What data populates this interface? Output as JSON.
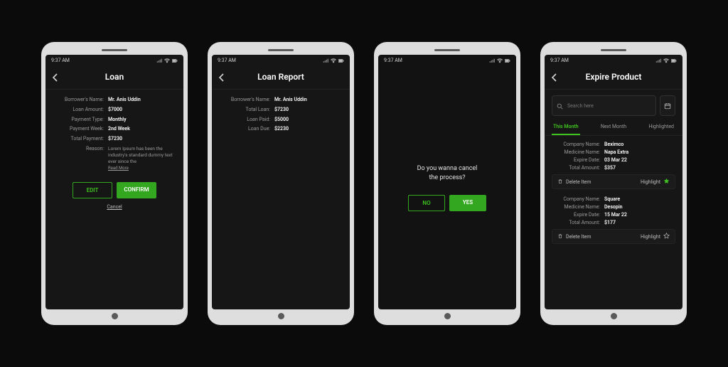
{
  "status": {
    "time": "9:37 AM"
  },
  "screen1": {
    "title": "Loan",
    "fields": {
      "borrower_label": "Borrower's Name:",
      "borrower_value": "Mr. Anis Uddin",
      "loan_amount_label": "Loan Amount:",
      "loan_amount_value": "$7000",
      "payment_type_label": "Payment Type:",
      "payment_type_value": "Monthly",
      "payment_week_label": "Payment Week:",
      "payment_week_value": "2nd Week",
      "total_payment_label": "Total Payment:",
      "total_payment_value": "$7230",
      "reason_label": "Reason:",
      "reason_value": "Lorem Ipsum has been the industry's standard dummy text ever since the",
      "readmore": "Read More"
    },
    "buttons": {
      "edit": "EDIT",
      "confirm": "CONFIRM",
      "cancel": "Cancel"
    }
  },
  "screen2": {
    "title": "Loan Report",
    "fields": {
      "borrower_label": "Borrower's Name:",
      "borrower_value": "Mr. Anis Uddin",
      "total_loan_label": "Total Loan:",
      "total_loan_value": "$7230",
      "loan_paid_label": "Loan Paid:",
      "loan_paid_value": "$5000",
      "loan_due_label": "Loan Due:",
      "loan_due_value": "$2230"
    }
  },
  "screen3": {
    "prompt_l1": "Do you wanna cancel",
    "prompt_l2": "the process?",
    "no": "NO",
    "yes": "YES"
  },
  "screen4": {
    "title": "Expire Product",
    "search_placeholder": "Search here",
    "tabs": {
      "this": "This Month",
      "next": "Next Month",
      "highlighted": "Highlighted"
    },
    "labels": {
      "company": "Company Name:",
      "medicine": "Medicine Name:",
      "expire": "Expire Date:",
      "total": "Total Amount:",
      "delete": "Delete Item",
      "highlight": "Highlight"
    },
    "items": [
      {
        "company": "Beximco",
        "medicine": "Napa Extra",
        "expire": "03 Mar 22",
        "total": "$357",
        "highlighted": true
      },
      {
        "company": "Square",
        "medicine": "Desopin",
        "expire": "15 Mar 22",
        "total": "$177",
        "highlighted": false
      }
    ]
  }
}
